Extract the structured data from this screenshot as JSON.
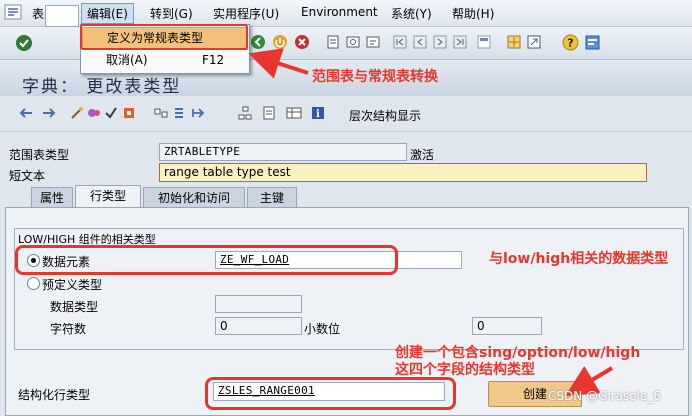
{
  "menubar": {
    "items": [
      "表类型",
      "编辑(E)",
      "转到(G)",
      "实用程序(U)",
      "Environment",
      "系统(Y)",
      "帮助(H)"
    ]
  },
  "dropdown": {
    "items": [
      {
        "label": "定义为常规表类型",
        "shortcut": ""
      },
      {
        "label": "取消(A)",
        "shortcut": "F12"
      }
    ]
  },
  "title": "字典： 更改表类型",
  "app_toolbar": {
    "hierarchy_label": "层次结构显示"
  },
  "header_fields": {
    "range_type_label": "范围表类型",
    "range_type_value": "ZRTABLETYPE",
    "status": "激活",
    "short_text_label": "短文本",
    "short_text_value": "range table type test"
  },
  "tabs": [
    "属性",
    "行类型",
    "初始化和访问",
    "主键"
  ],
  "group": {
    "title": "LOW/HIGH 组件的相关类型",
    "data_element_label": "数据元素",
    "data_element_value": "ZE_WF_LOAD",
    "predefined_label": "预定义类型",
    "data_type_label": "数据类型",
    "data_type_value": "",
    "chars_label": "字符数",
    "chars_value": "0",
    "decimals_label": "小数位",
    "decimals_value": "0"
  },
  "structured_row": {
    "label": "结构化行类型",
    "value": "ZSLES_RANGE001",
    "create_label": "创建"
  },
  "annotations": {
    "a1": "范围表与常规表转换",
    "a2": "与low/high相关的数据类型",
    "a3_line1": "创建一个包含sing/option/low/high",
    "a3_line2": "这四个字段的结构类型"
  },
  "watermark": "CSDN @Girasole_6",
  "colors": {
    "annotation": "#e8362d",
    "highlight": "#f3c27a",
    "input_yellow": "#fbf0bf"
  }
}
